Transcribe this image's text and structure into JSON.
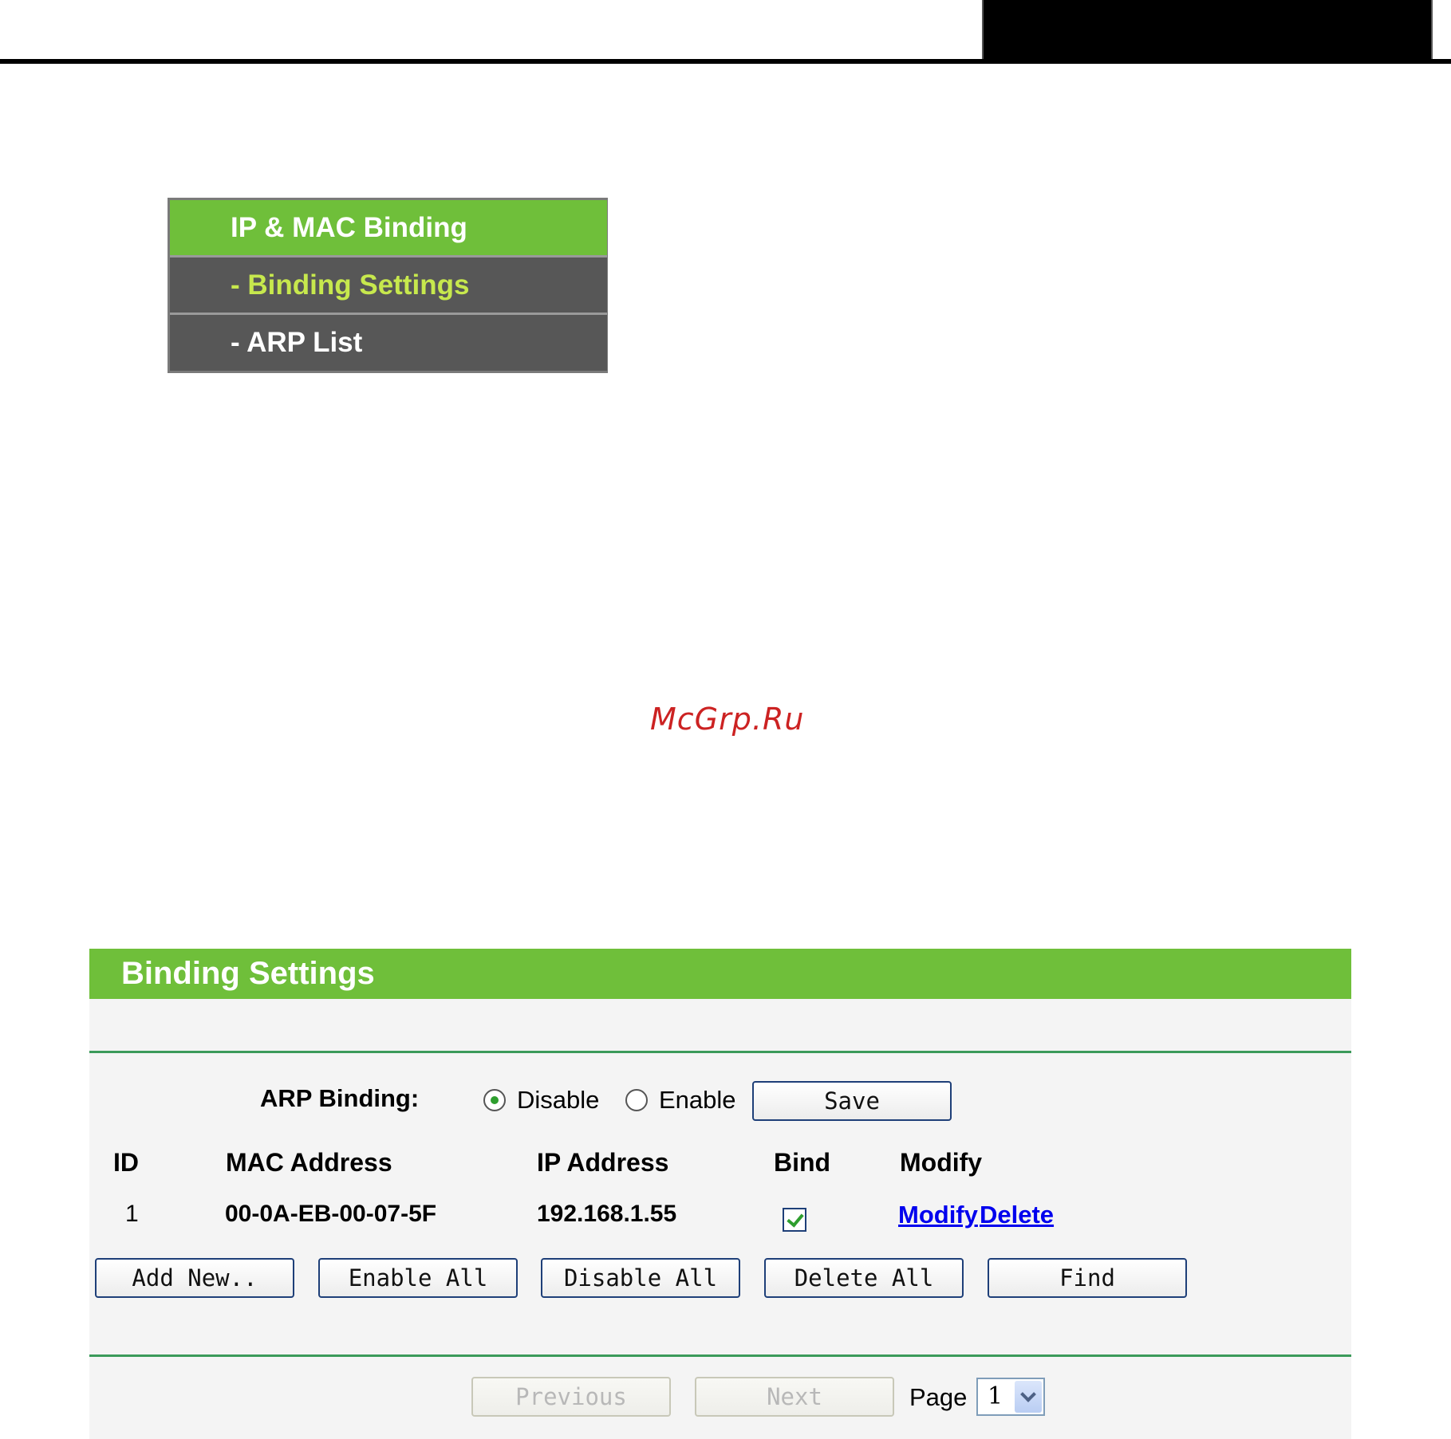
{
  "menu": {
    "header": "IP & MAC Binding",
    "items": [
      {
        "label": "- Binding Settings",
        "active": true
      },
      {
        "label": "- ARP List",
        "active": false
      }
    ]
  },
  "watermark": "McGrp.Ru",
  "panel": {
    "title": "Binding Settings",
    "arp_binding": {
      "label": "ARP Binding:",
      "options": [
        "Disable",
        "Enable"
      ],
      "selected": "Disable",
      "save_label": "Save"
    },
    "table": {
      "headers": [
        "ID",
        "MAC Address",
        "IP Address",
        "Bind",
        "Modify"
      ],
      "rows": [
        {
          "id": "1",
          "mac": "00-0A-EB-00-07-5F",
          "ip": "192.168.1.55",
          "bind": true,
          "modify_label": "Modify",
          "delete_label": "Delete"
        }
      ]
    },
    "actions": [
      "Add New..",
      "Enable All",
      "Disable All",
      "Delete All",
      "Find"
    ],
    "pagination": {
      "previous_label": "Previous",
      "next_label": "Next",
      "page_label": "Page",
      "page_value": "1"
    }
  },
  "colors": {
    "accent_green": "#6fbf3a",
    "menu_gray": "#575757",
    "active_text": "#c7e84d",
    "link_blue": "#0000ee"
  }
}
